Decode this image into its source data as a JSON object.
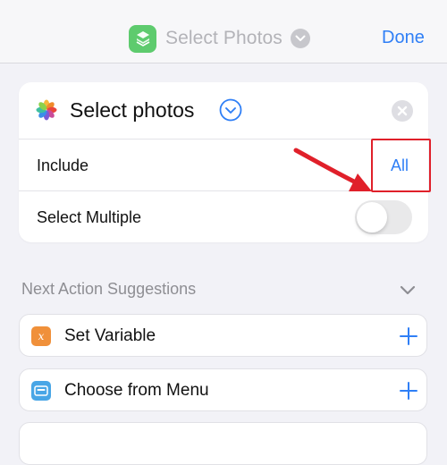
{
  "nav": {
    "title": "Select Photos",
    "done_label": "Done"
  },
  "action_card": {
    "title": "Select photos",
    "rows": [
      {
        "label": "Include",
        "value": "All"
      },
      {
        "label": "Select Multiple",
        "toggle_on": false
      }
    ]
  },
  "suggestions": {
    "header": "Next Action Suggestions",
    "items": [
      {
        "label": "Set Variable",
        "icon": "variable-icon",
        "icon_color": "#f0903a"
      },
      {
        "label": "Choose from Menu",
        "icon": "menu-icon",
        "icon_color": "#49a6e6"
      },
      {
        "label": "",
        "icon": "",
        "icon_color": ""
      }
    ]
  },
  "colors": {
    "accent": "#2f7ff6",
    "shortcuts_green": "#5ecb6e",
    "annotation_red": "#e0202a"
  }
}
